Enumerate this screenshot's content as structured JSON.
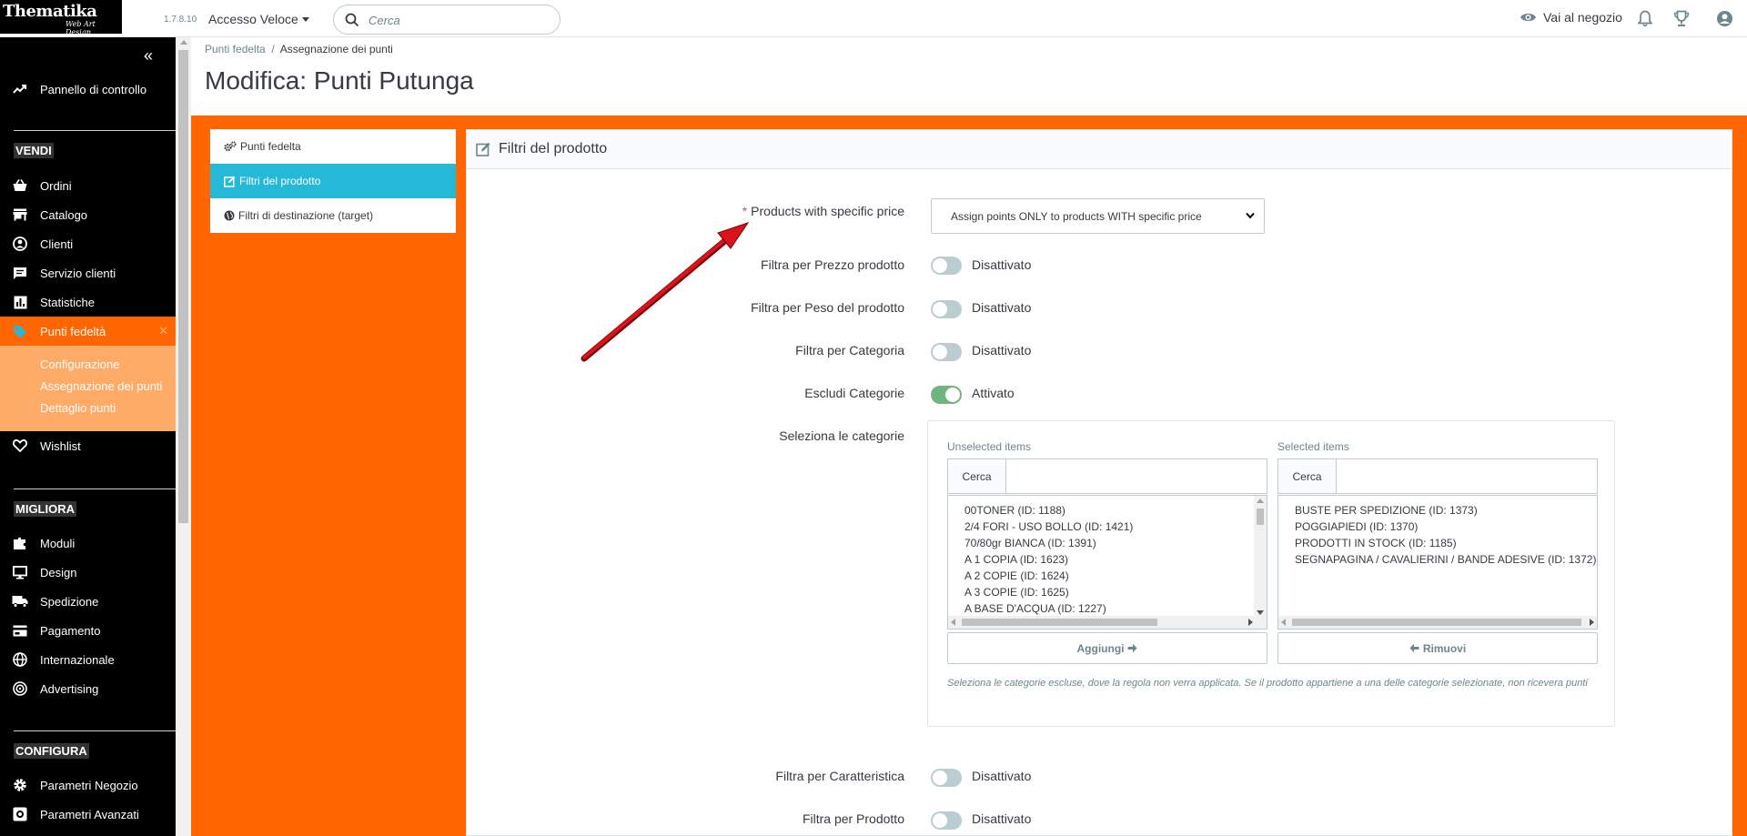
{
  "app": {
    "logo_line1": "Thematika",
    "logo_line2": "Web Art Design",
    "version": "1.7.8.10",
    "quick_access": "Accesso Veloce",
    "search_placeholder": "Cerca",
    "shop_link": "Vai al negozio"
  },
  "sidebar": {
    "dashboard": "Pannello di controllo",
    "section_sell": "VENDI",
    "orders": "Ordini",
    "catalog": "Catalogo",
    "customers": "Clienti",
    "customer_service": "Servizio clienti",
    "stats": "Statistiche",
    "loyalty": "Punti fedeltà",
    "sub_config": "Configurazione",
    "sub_assign": "Assegnazione dei punti",
    "sub_detail": "Dettaglio punti",
    "wishlist": "Wishlist",
    "section_improve": "MIGLIORA",
    "modules": "Moduli",
    "design": "Design",
    "shipping": "Spedizione",
    "payment": "Pagamento",
    "international": "Internazionale",
    "advertising": "Advertising",
    "section_configure": "CONFIGURA",
    "shop_params": "Parametri Negozio",
    "advanced_params": "Parametri Avanzati"
  },
  "header": {
    "breadcrumb_parent": "Punti fedelta",
    "breadcrumb_sep": "/",
    "breadcrumb_current": "Assegnazione dei punti",
    "title": "Modifica: Punti Putunga"
  },
  "tabs": [
    {
      "label": "Punti fedelta"
    },
    {
      "label": "Filtri del prodotto"
    },
    {
      "label": "Filtri di destinazione (target)"
    }
  ],
  "panel": {
    "title": "Filtri del prodotto",
    "required_mark": "*",
    "specific_price_label": "Products with specific price",
    "specific_price_value": "Assign points ONLY to products WITH specific price",
    "rows": [
      {
        "label": "Filtra per Prezzo prodotto",
        "state": "Disattivato"
      },
      {
        "label": "Filtra per Peso del prodotto",
        "state": "Disattivato"
      },
      {
        "label": "Filtra per Categoria",
        "state": "Disattivato"
      },
      {
        "label": "Escludi Categorie",
        "state": "Attivato"
      }
    ],
    "categories_label": "Seleziona le categorie",
    "unselected_label": "Unselected items",
    "selected_label": "Selected items",
    "search_addon": "Cerca",
    "unselected_items": [
      "00TONER (ID: 1188)",
      "2/4 FORI - USO BOLLO (ID: 1421)",
      "70/80gr BIANCA (ID: 1391)",
      "A 1 COPIA (ID: 1623)",
      "A 2 COPIE (ID: 1624)",
      "A 3 COPIE (ID: 1625)",
      "A BASE D'ACQUA (ID: 1227)"
    ],
    "selected_items": [
      "BUSTE PER SPEDIZIONE (ID: 1373)",
      "POGGIAPIEDI (ID: 1370)",
      "PRODOTTI IN STOCK (ID: 1185)",
      "SEGNAPAGINA / CAVALIERINI / BANDE ADESIVE (ID: 1372)"
    ],
    "add_button": "Aggiungi",
    "remove_button": "Rimuovi",
    "help_text": "Seleziona le categorie escluse, dove la regola non verra applicata. Se il prodotto appartiene a una delle categorie selezionate, non ricevera punti",
    "rows_bottom": [
      {
        "label": "Filtra per Caratteristica",
        "state": "Disattivato"
      },
      {
        "label": "Filtra per Prodotto",
        "state": "Disattivato"
      }
    ]
  },
  "colors": {
    "accent": "#25b9d7",
    "brand_orange": "#ff6600",
    "switch_on": "#70b580",
    "annotation_arrow": "#d9141b"
  }
}
